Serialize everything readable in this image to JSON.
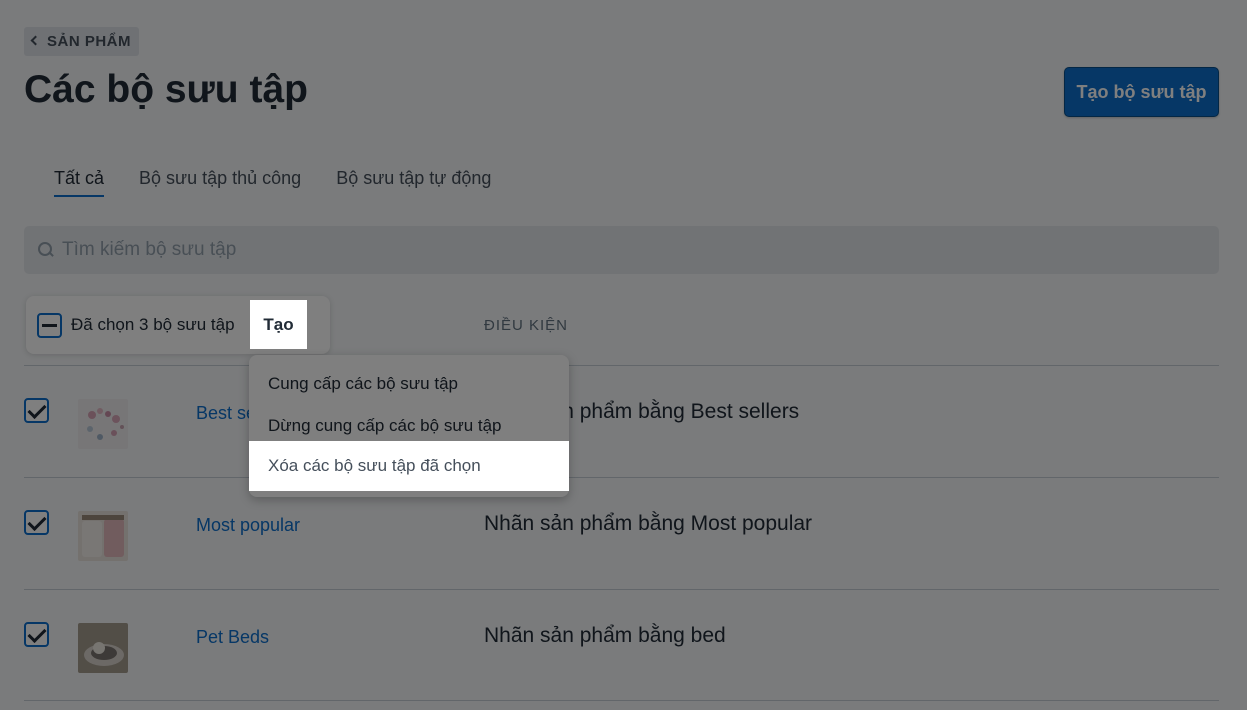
{
  "breadcrumb": {
    "label": "SẢN PHẨM"
  },
  "page": {
    "title": "Các bộ sưu tập",
    "create_button": "Tạo bộ sưu tập"
  },
  "tabs": [
    {
      "label": "Tất cả",
      "active": true
    },
    {
      "label": "Bộ sưu tập thủ công",
      "active": false
    },
    {
      "label": "Bộ sưu tập tự động",
      "active": false
    }
  ],
  "search": {
    "placeholder": "Tìm kiếm bộ sưu tập",
    "value": ""
  },
  "table": {
    "condition_header": "ĐIỀU KIỆN",
    "bulk_selected_text": "Đã chọn 3 bộ sưu tập",
    "bulk_action_label": "Tạo",
    "rows": [
      {
        "name": "Best sellers",
        "condition": "Nhãn sản phẩm bằng Best sellers",
        "checked": true
      },
      {
        "name": "Most popular",
        "condition": "Nhãn sản phẩm bằng Most popular",
        "checked": true
      },
      {
        "name": "Pet Beds",
        "condition": "Nhãn sản phẩm bằng bed",
        "checked": true
      }
    ]
  },
  "dropdown": {
    "items": [
      {
        "label": "Cung cấp các bộ sưu tập"
      },
      {
        "label": "Dừng cung cấp các bộ sưu tập"
      },
      {
        "label": "Xóa các bộ sưu tập đã chọn",
        "highlighted": true
      }
    ]
  },
  "colors": {
    "accent": "#0c6ecc",
    "overlay": "rgba(0,0,0,0.5)"
  }
}
